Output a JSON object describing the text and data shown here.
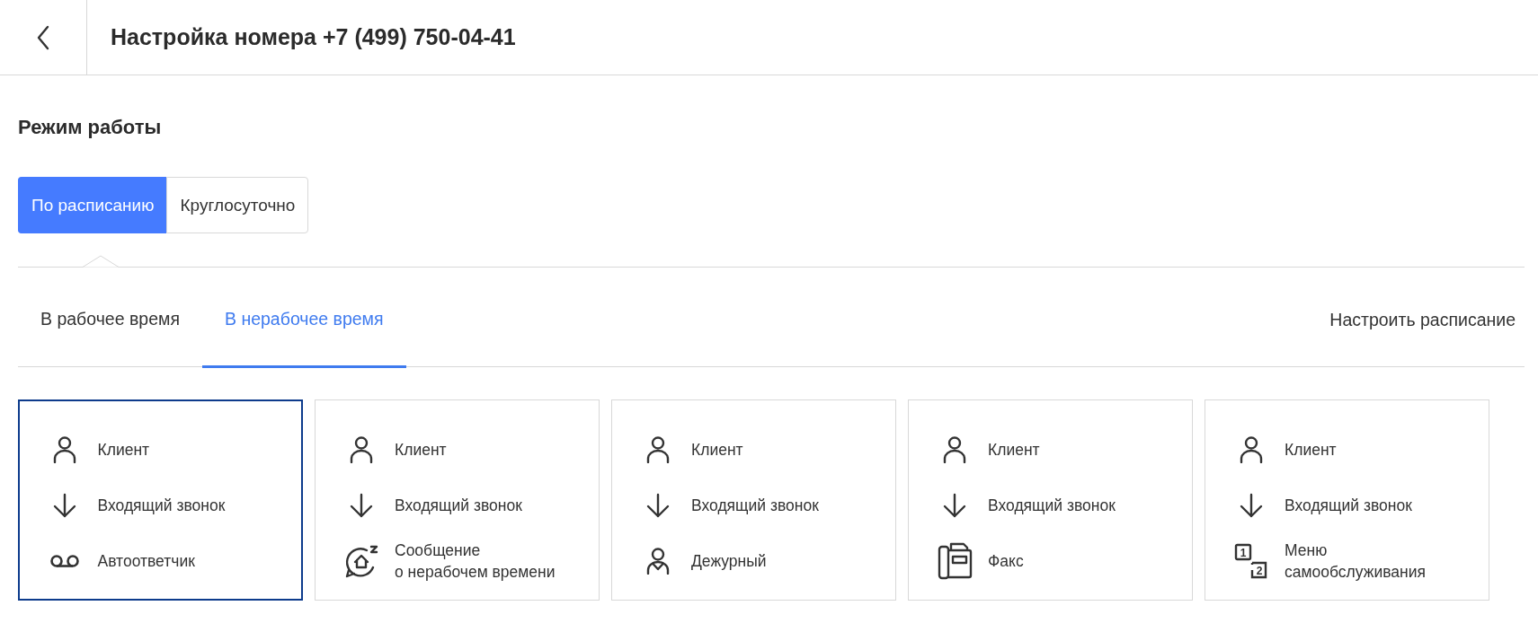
{
  "header": {
    "title": "Настройка номера +7 (499) 750-04-41"
  },
  "section_title": "Режим работы",
  "mode_options": [
    {
      "label": "По расписанию",
      "selected": true
    },
    {
      "label": "Круглосуточно",
      "selected": false
    }
  ],
  "tabs": [
    {
      "label": "В рабочее время",
      "selected": false
    },
    {
      "label": "В нерабочее время",
      "selected": true
    }
  ],
  "schedule_link": "Настроить расписание",
  "scenarios": [
    {
      "selected": true,
      "steps": [
        {
          "kind": "client",
          "label": "Клиент"
        },
        {
          "kind": "incoming",
          "label": "Входящий звонок"
        },
        {
          "kind": "answering",
          "label": "Автоответчик"
        }
      ]
    },
    {
      "selected": false,
      "steps": [
        {
          "kind": "client",
          "label": "Клиент"
        },
        {
          "kind": "incoming",
          "label": "Входящий звонок"
        },
        {
          "kind": "message",
          "label": "Сообщение\nо нерабочем времени"
        }
      ]
    },
    {
      "selected": false,
      "steps": [
        {
          "kind": "client",
          "label": "Клиент"
        },
        {
          "kind": "incoming",
          "label": "Входящий звонок"
        },
        {
          "kind": "duty",
          "label": "Дежурный"
        }
      ]
    },
    {
      "selected": false,
      "steps": [
        {
          "kind": "client",
          "label": "Клиент"
        },
        {
          "kind": "incoming",
          "label": "Входящий звонок"
        },
        {
          "kind": "fax",
          "label": "Факс"
        }
      ]
    },
    {
      "selected": false,
      "steps": [
        {
          "kind": "client",
          "label": "Клиент"
        },
        {
          "kind": "incoming",
          "label": "Входящий звонок"
        },
        {
          "kind": "menu",
          "label": "Меню\nсамообслуживания",
          "icon_labels": [
            "1",
            "2"
          ]
        }
      ]
    }
  ]
}
